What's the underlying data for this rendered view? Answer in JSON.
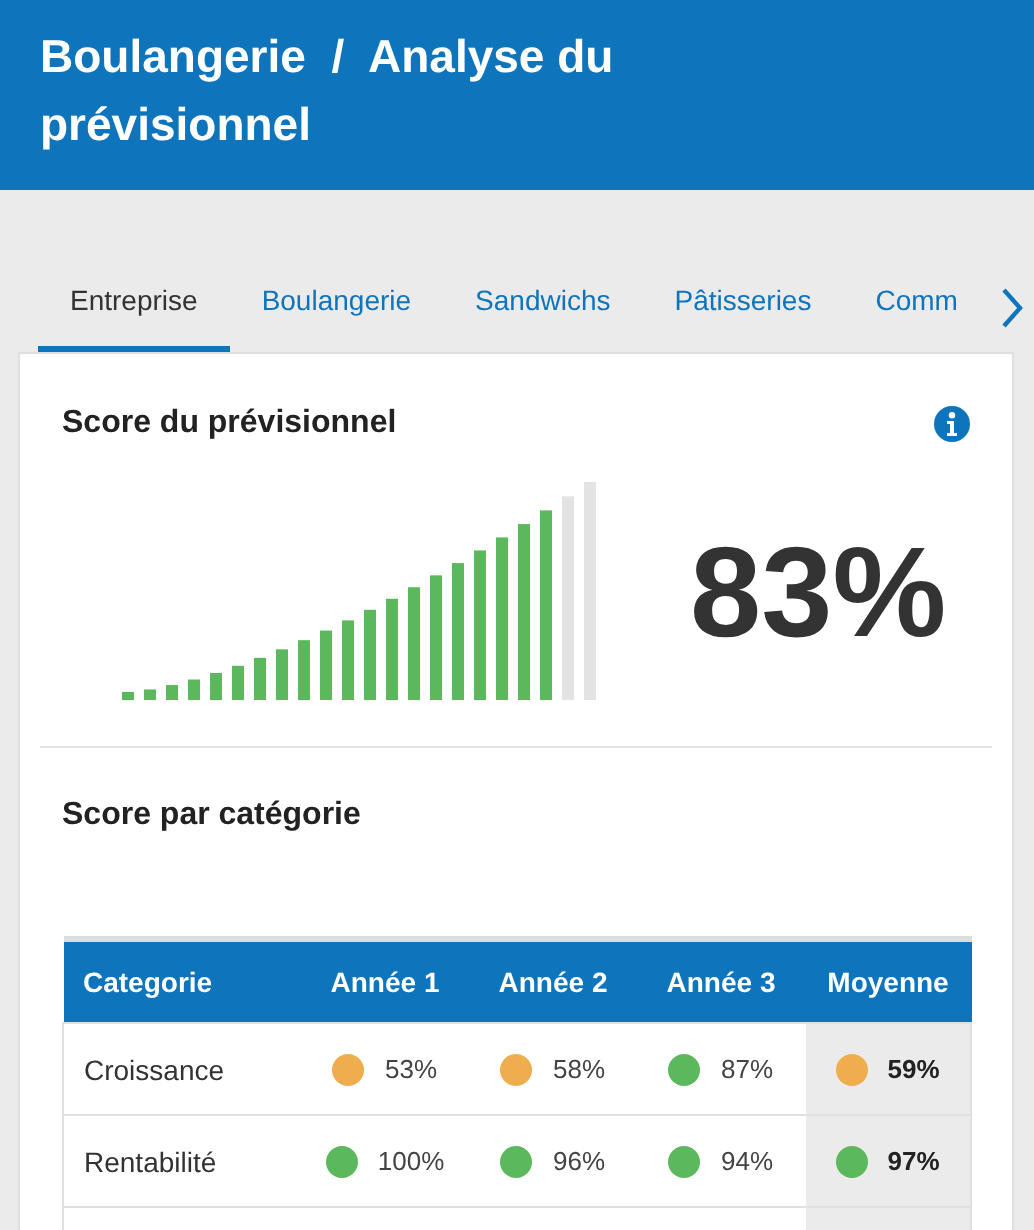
{
  "header": {
    "title": "Boulangerie  /  Analyse du prévisionnel"
  },
  "tabs": [
    {
      "label": "Entreprise",
      "selected": true
    },
    {
      "label": "Boulangerie",
      "selected": false
    },
    {
      "label": "Sandwichs",
      "selected": false
    },
    {
      "label": "Pâtisseries",
      "selected": false
    },
    {
      "label": "Comm",
      "selected": false
    }
  ],
  "forecast_score": {
    "title": "Score du prévisionnel",
    "level": 0.91,
    "value": "83%"
  },
  "category_score": {
    "title": "Score par catégorie",
    "columns": [
      "Categorie",
      "Année 1",
      "Année 2",
      "Année 3",
      "Moyenne"
    ],
    "rows": [
      {
        "cells": [
          {
            "kind": "label",
            "value": "Croissance"
          },
          {
            "kind": "score",
            "value": "53%",
            "color": "#f0ad4e"
          },
          {
            "kind": "score",
            "value": "58%",
            "color": "#f0ad4e"
          },
          {
            "kind": "score",
            "value": "87%",
            "color": "#5cb85c"
          },
          {
            "kind": "average",
            "value": "59%",
            "color": "#f0ad4e"
          }
        ]
      },
      {
        "cells": [
          {
            "kind": "label",
            "value": "Rentabilité"
          },
          {
            "kind": "score",
            "value": "100%",
            "color": "#5cb85c"
          },
          {
            "kind": "score",
            "value": "96%",
            "color": "#5cb85c"
          },
          {
            "kind": "score",
            "value": "94%",
            "color": "#5cb85c"
          },
          {
            "kind": "average",
            "value": "97%",
            "color": "#5cb85c"
          }
        ]
      }
    ]
  }
}
